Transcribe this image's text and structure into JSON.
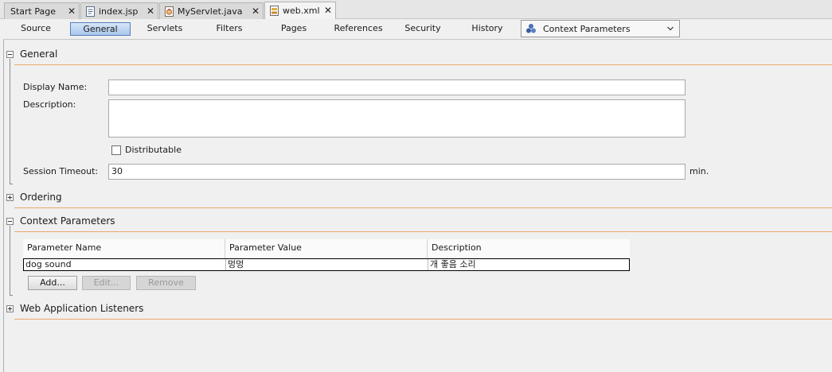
{
  "document_tabs": [
    {
      "label": "Start Page",
      "icon": "none",
      "active": false
    },
    {
      "label": "index.jsp",
      "icon": "jsp-file-icon",
      "active": false
    },
    {
      "label": "MyServlet.java",
      "icon": "java-file-icon",
      "active": false
    },
    {
      "label": "web.xml",
      "icon": "xml-file-icon",
      "active": true
    }
  ],
  "close_glyph": "✕",
  "view_tabs": [
    "Source",
    "General",
    "Servlets",
    "Filters",
    "Pages",
    "References",
    "Security",
    "History"
  ],
  "selected_view": "General",
  "section_combo": {
    "value": "Context Parameters",
    "icon": "cluster-icon"
  },
  "general": {
    "title": "General",
    "display_name_label": "Display Name:",
    "display_name_value": "",
    "description_label": "Description:",
    "description_value": "",
    "distributable_label": "Distributable",
    "distributable_checked": false,
    "session_timeout_label": "Session Timeout:",
    "session_timeout_value": "30",
    "session_timeout_unit": "min."
  },
  "ordering": {
    "title": "Ordering",
    "expanded": false
  },
  "context_parameters": {
    "title": "Context Parameters",
    "expanded": true,
    "columns": [
      "Parameter Name",
      "Parameter Value",
      "Description"
    ],
    "rows": [
      {
        "name": "dog sound",
        "value": "멍멍",
        "description": "개 좋음 소리"
      }
    ],
    "buttons": {
      "add": "Add...",
      "edit": "Edit...",
      "remove": "Remove"
    }
  },
  "listeners": {
    "title": "Web Application Listeners",
    "expanded": false
  },
  "colors": {
    "section_rule": "#e9a86a",
    "selection": "#a9c6ec",
    "accent_border": "#5680b8"
  }
}
